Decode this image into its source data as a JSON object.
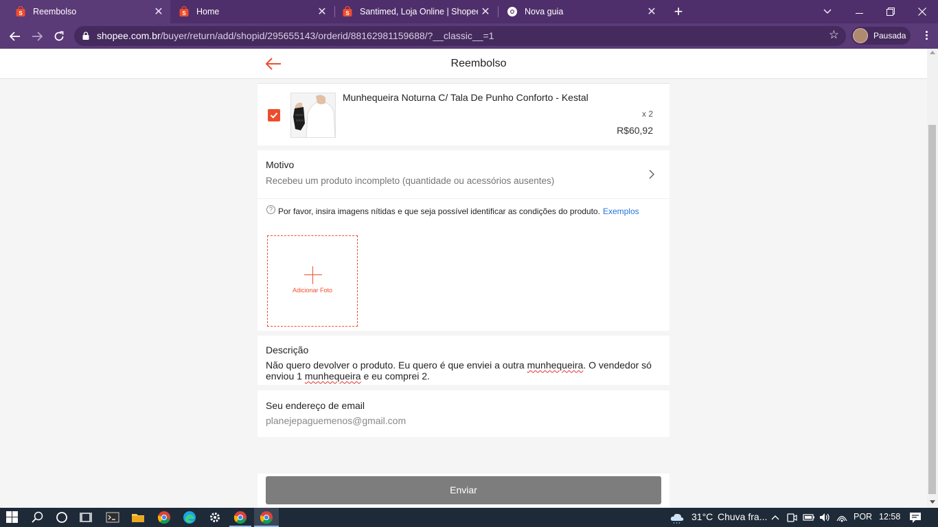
{
  "browser": {
    "tabs": [
      {
        "title": "Reembolso",
        "icon": "shopee-icon",
        "active": true
      },
      {
        "title": "Home",
        "icon": "shopee-icon",
        "active": false
      },
      {
        "title": "Santimed, Loja Online | Shopee B",
        "icon": "shopee-icon",
        "active": false
      },
      {
        "title": "Nova guia",
        "icon": "chrome-icon",
        "active": false
      }
    ],
    "url_domain": "shopee.com.br",
    "url_path": "/buyer/return/add/shopid/295655143/orderid/88162981159688/?__classic__=1",
    "profile_label": "Pausada",
    "theme_color": "#5b3a78"
  },
  "header": {
    "title": "Reembolso"
  },
  "product": {
    "name": "Munhequeira Noturna C/ Tala De Punho Conforto - Kestal",
    "quantity": "x 2",
    "price": "R$60,92",
    "checked": true
  },
  "reason": {
    "label": "Motivo",
    "value": "Recebeu um produto incompleto (quantidade ou acessórios ausentes)"
  },
  "photos": {
    "hint": "Por favor, insira imagens nítidas e que seja possível identificar as condições do produto.",
    "hint_link": "Exemplos",
    "add_label": "Adicionar Foto"
  },
  "description": {
    "label": "Descrição",
    "text_parts": [
      "Não quero devolver o produto. Eu quero é que enviei a outra ",
      "munhequeira",
      ". O vendedor só enviou 1 ",
      "munhequeira",
      " e eu comprei 2."
    ]
  },
  "email": {
    "label": "Seu endereço de email",
    "value": "planejepaguemenos@gmail.com"
  },
  "submit": {
    "label": "Enviar"
  },
  "colors": {
    "accent": "#ee4d2d",
    "link": "#2673dd",
    "button_disabled": "#7d7d7d"
  },
  "taskbar": {
    "weather_temp": "31°C",
    "weather_text": "Chuva fra...",
    "language": "POR",
    "time": "12:58"
  }
}
